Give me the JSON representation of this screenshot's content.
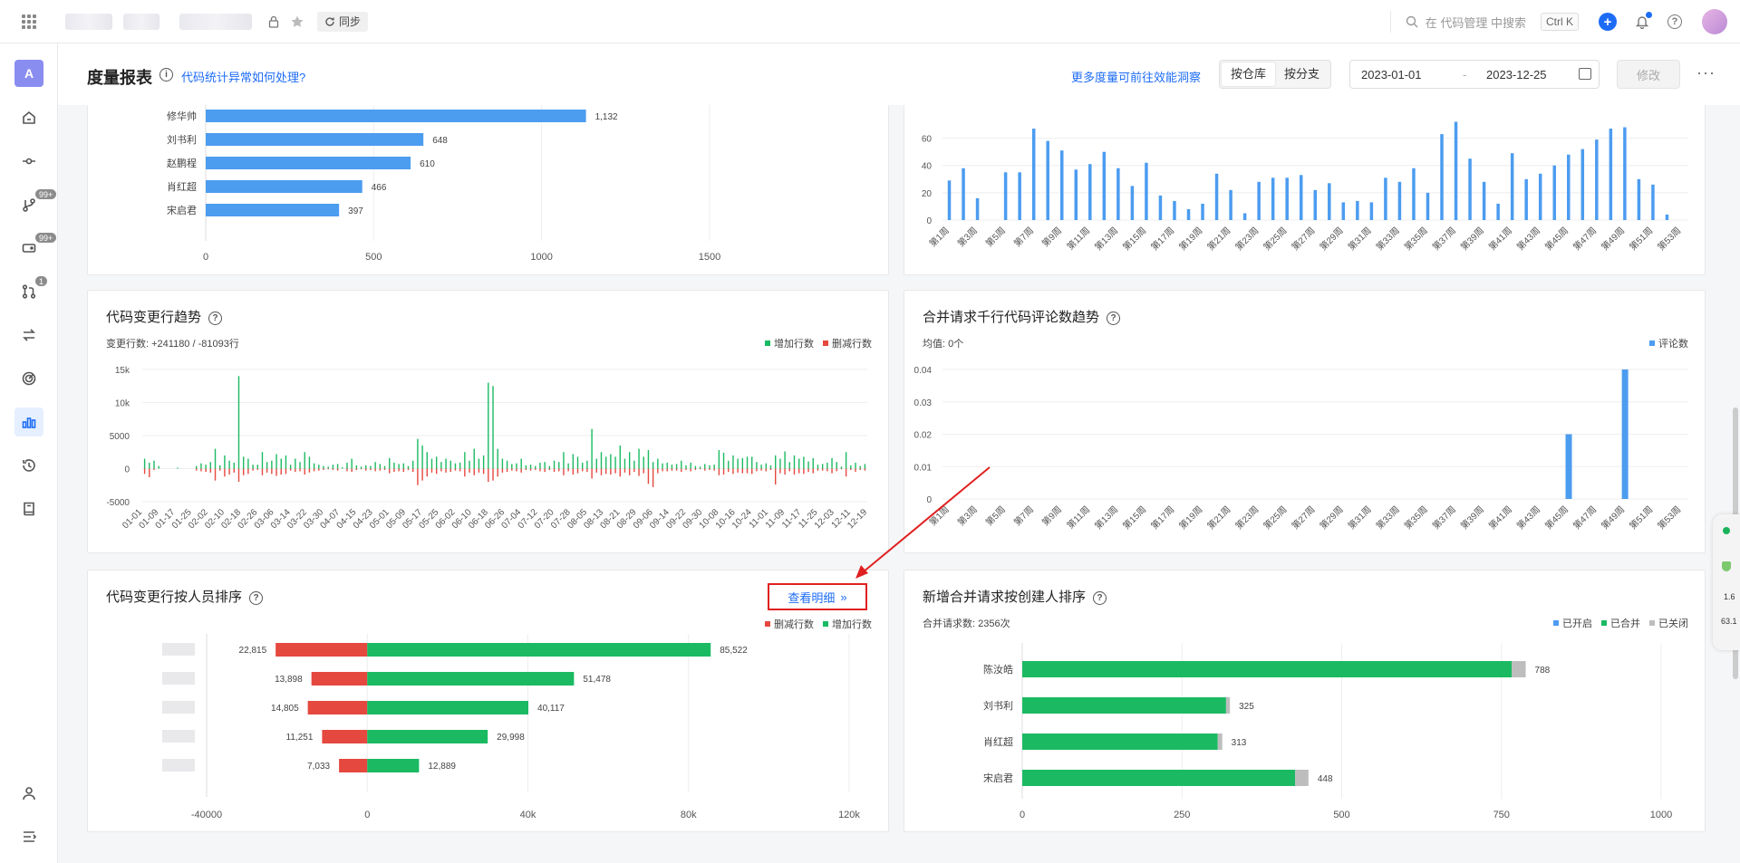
{
  "topbar": {
    "sync_label": "同步",
    "search_placeholder": "在 代码管理 中搜索",
    "shortcut": "Ctrl K",
    "plus": "+",
    "help": "?"
  },
  "sidebar": {
    "avatar_letter": "A",
    "badges": {
      "branch": "99+",
      "tag": "99+",
      "merge": "1"
    }
  },
  "header": {
    "title": "度量报表",
    "info_icon": "i",
    "info_link": "代码统计异常如何处理?",
    "more_link": "更多度量可前往效能洞察",
    "tabs": [
      "按仓库",
      "按分支"
    ],
    "date_start": "2023-01-01",
    "date_sep": "-",
    "date_end": "2023-12-25",
    "modify": "修改",
    "more": "···"
  },
  "panel_code_trend": {
    "title": "代码变更行趋势",
    "subtitle": "变更行数: +241180 / -81093行",
    "legend": [
      "增加行数",
      "删减行数"
    ]
  },
  "panel_comment_trend": {
    "title": "合并请求千行代码评论数趋势",
    "subtitle": "均值: 0个",
    "legend": [
      "评论数"
    ]
  },
  "panel_person_rank": {
    "title": "代码变更行按人员排序",
    "detail_button": "查看明细",
    "detail_chevron": "»",
    "legend": [
      "删减行数",
      "增加行数"
    ]
  },
  "panel_mr_rank": {
    "title": "新增合并请求按创建人排序",
    "subtitle": "合并请求数: 2356次",
    "legend": [
      "已开启",
      "已合并",
      "已关闭"
    ]
  },
  "float_widget": {
    "a": "1.6",
    "b": "63.1"
  },
  "colors": {
    "blue": "#4c9cf0",
    "green": "#1bba62",
    "red": "#e5483f",
    "gray": "#bdbdbd",
    "link": "#1d6cf6"
  },
  "chart_data": [
    {
      "type": "bar",
      "orientation": "horizontal",
      "partial": "top-left panel, scrolled",
      "categories": [
        "修华帅",
        "刘书利",
        "赵鹏程",
        "肖红超",
        "宋启君"
      ],
      "values": [
        1132,
        648,
        610,
        466,
        397
      ],
      "data_labels": [
        "1,132",
        "648",
        "610",
        "466",
        "397"
      ],
      "x_ticks": [
        "0",
        "500",
        "1000",
        "1500"
      ],
      "xlim": [
        0,
        1500
      ]
    },
    {
      "type": "bar",
      "partial": "top-right panel, scrolled",
      "categories": [
        "第1周",
        "第2周",
        "第3周",
        "第4周",
        "第5周",
        "第6周",
        "第7周",
        "第8周",
        "第9周",
        "第10周",
        "第11周",
        "第12周",
        "第13周",
        "第14周",
        "第15周",
        "第16周",
        "第17周",
        "第18周",
        "第19周",
        "第20周",
        "第21周",
        "第22周",
        "第23周",
        "第24周",
        "第25周",
        "第26周",
        "第27周",
        "第28周",
        "第29周",
        "第30周",
        "第31周",
        "第32周",
        "第33周",
        "第34周",
        "第35周",
        "第36周",
        "第37周",
        "第38周",
        "第39周",
        "第40周",
        "第41周",
        "第42周",
        "第43周",
        "第44周",
        "第45周",
        "第46周",
        "第47周",
        "第48周",
        "第49周",
        "第50周",
        "第51周",
        "第52周",
        "第53周"
      ],
      "values": [
        29,
        38,
        16,
        0,
        35,
        35,
        67,
        58,
        51,
        37,
        41,
        50,
        38,
        25,
        42,
        18,
        14,
        8,
        12,
        34,
        22,
        5,
        28,
        31,
        31,
        33,
        22,
        27,
        13,
        14,
        13,
        31,
        28,
        38,
        20,
        63,
        72,
        45,
        28,
        12,
        49,
        30,
        34,
        40,
        48,
        52,
        59,
        67,
        68,
        30,
        26,
        4,
        0
      ],
      "x_tick_labels": [
        "第1周",
        "第3周",
        "第5周",
        "第7周",
        "第9周",
        "第11周",
        "第13周",
        "第15周",
        "第17周",
        "第19周",
        "第21周",
        "第23周",
        "第25周",
        "第27周",
        "第29周",
        "第31周",
        "第33周",
        "第35周",
        "第37周",
        "第39周",
        "第41周",
        "第43周",
        "第45周",
        "第47周",
        "第49周",
        "第51周",
        "第53周"
      ],
      "y_ticks": [
        "0",
        "20",
        "40",
        "60"
      ],
      "ylim": [
        0,
        75
      ]
    },
    {
      "type": "bar",
      "title": "代码变更行趋势",
      "series": [
        {
          "name": "增加行数",
          "color": "#1bba62",
          "values": [
            1500,
            900,
            1200,
            400,
            0,
            0,
            0,
            150,
            0,
            0,
            0,
            400,
            800,
            600,
            1000,
            3000,
            500,
            2000,
            1200,
            900,
            14000,
            1800,
            1500,
            600,
            600,
            2500,
            1000,
            1200,
            2200,
            1500,
            2000,
            600,
            1500,
            1000,
            2500,
            1800,
            800,
            600,
            400,
            300,
            600,
            700,
            200,
            900,
            1500,
            500,
            300,
            500,
            400,
            1000,
            700,
            400,
            1600,
            900,
            700,
            800,
            400,
            1200,
            4500,
            3500,
            2500,
            1500,
            1800,
            1000,
            1500,
            1200,
            800,
            900,
            2500,
            1200,
            3000,
            1500,
            2000,
            13000,
            12500,
            3000,
            1500,
            1200,
            700,
            800,
            1500,
            500,
            600,
            400,
            900,
            1000,
            400,
            1200,
            1000,
            2500,
            800,
            2200,
            1800,
            900,
            1200,
            6000,
            1500,
            2500,
            1800,
            2200,
            1800,
            3500,
            1500,
            2500,
            1200,
            3000,
            1800,
            2800,
            1000,
            1500,
            800,
            900,
            600,
            700,
            1200,
            500,
            900,
            400,
            300,
            700,
            500,
            600,
            2800,
            2400,
            1200,
            2000,
            1500,
            1600,
            1800,
            1800,
            1000,
            600,
            800,
            500,
            2000,
            1500,
            2600,
            1000,
            2000,
            1500,
            1800,
            1100,
            1600,
            600,
            700,
            900,
            1600,
            1000,
            300,
            2500,
            500,
            900,
            400,
            700
          ]
        },
        {
          "name": "删减行数",
          "color": "#e5483f",
          "values": [
            -800,
            -1300,
            -200,
            0,
            0,
            0,
            0,
            0,
            0,
            0,
            0,
            -300,
            -400,
            -500,
            -600,
            -1800,
            -300,
            -1200,
            -900,
            -600,
            -2000,
            -1000,
            -800,
            -300,
            -200,
            -1000,
            -600,
            -800,
            -1100,
            -900,
            -800,
            -300,
            -500,
            -400,
            -900,
            -600,
            -400,
            -300,
            -200,
            -100,
            -200,
            -300,
            0,
            -400,
            -500,
            -200,
            -100,
            -300,
            -200,
            -400,
            -300,
            -200,
            -700,
            -500,
            -400,
            -500,
            -200,
            -500,
            -2500,
            -1800,
            -1200,
            -600,
            -800,
            -400,
            -600,
            -500,
            -300,
            -400,
            -1200,
            -600,
            -1000,
            -600,
            -800,
            -2000,
            -1800,
            -1200,
            -600,
            -500,
            -300,
            -400,
            -600,
            -200,
            -300,
            -200,
            -400,
            -500,
            -200,
            -500,
            -400,
            -1000,
            -400,
            -900,
            -700,
            -400,
            -500,
            -1500,
            -600,
            -1000,
            -800,
            -900,
            -700,
            -1200,
            -600,
            -1000,
            -500,
            -1100,
            -700,
            -2300,
            -2800,
            -700,
            -400,
            -400,
            -300,
            -300,
            -500,
            -200,
            -400,
            -200,
            -100,
            -300,
            -200,
            -300,
            -1000,
            -900,
            -500,
            -800,
            -600,
            -700,
            -700,
            -800,
            -400,
            -300,
            -400,
            -200,
            -2400,
            -700,
            -900,
            -400,
            -900,
            -700,
            -800,
            -500,
            -700,
            -300,
            -300,
            -400,
            -700,
            -400,
            -100,
            -1200,
            -200,
            -500,
            -200,
            -300
          ]
        }
      ],
      "x_tick_labels": [
        "01-01",
        "01-09",
        "01-17",
        "01-25",
        "02-02",
        "02-10",
        "02-18",
        "02-26",
        "03-06",
        "03-14",
        "03-22",
        "03-30",
        "04-07",
        "04-15",
        "04-23",
        "05-01",
        "05-09",
        "05-17",
        "05-25",
        "06-02",
        "06-10",
        "06-18",
        "06-26",
        "07-04",
        "07-12",
        "07-20",
        "07-28",
        "08-05",
        "08-13",
        "08-21",
        "08-29",
        "09-06",
        "09-14",
        "09-22",
        "09-30",
        "10-08",
        "10-16",
        "10-24",
        "11-01",
        "11-09",
        "11-17",
        "11-25",
        "12-03",
        "12-11",
        "12-19"
      ],
      "y_ticks": [
        "15k",
        "10k",
        "5000",
        "0",
        "-5000"
      ],
      "ylim": [
        -5000,
        15000
      ]
    },
    {
      "type": "bar",
      "title": "合并请求千行代码评论数趋势",
      "series": [
        {
          "name": "评论数",
          "color": "#4c9cf0",
          "points": [
            {
              "x": "第45周",
              "y": 0.02
            },
            {
              "x": "第49周",
              "y": 0.04
            }
          ]
        }
      ],
      "x_tick_labels": [
        "第1周",
        "第3周",
        "第5周",
        "第7周",
        "第9周",
        "第11周",
        "第13周",
        "第15周",
        "第17周",
        "第19周",
        "第21周",
        "第23周",
        "第25周",
        "第27周",
        "第29周",
        "第31周",
        "第33周",
        "第35周",
        "第37周",
        "第39周",
        "第41周",
        "第43周",
        "第45周",
        "第47周",
        "第49周",
        "第51周",
        "第53周"
      ],
      "y_ticks": [
        "0",
        "0.01",
        "0.02",
        "0.03",
        "0.04"
      ],
      "ylim": [
        0,
        0.04
      ]
    },
    {
      "type": "bar",
      "orientation": "horizontal-diverging",
      "title": "代码变更行按人员排序",
      "series": [
        {
          "name": "删减行数",
          "color": "#e5483f",
          "values": [
            22815,
            13898,
            14805,
            11251,
            7033
          ],
          "data_labels": [
            "22,815",
            "13,898",
            "14,805",
            "11,251",
            "7,033"
          ]
        },
        {
          "name": "增加行数",
          "color": "#1bba62",
          "values": [
            85522,
            51478,
            40117,
            29998,
            12889
          ],
          "data_labels": [
            "85,522",
            "51,478",
            "40,117",
            "29,998",
            "12,889"
          ]
        }
      ],
      "x_ticks": [
        "-40000",
        "0",
        "40k",
        "80k",
        "120k"
      ],
      "xlim": [
        -40000,
        120000
      ]
    },
    {
      "type": "bar",
      "orientation": "horizontal-stacked",
      "title": "新增合并请求按创建人排序",
      "categories": [
        "陈汝皓",
        "刘书利",
        "肖红超",
        "宋启君"
      ],
      "series": [
        {
          "name": "已开启",
          "color": "#4c9cf0",
          "values": [
            0,
            0,
            0,
            0
          ]
        },
        {
          "name": "已合并",
          "color": "#1bba62",
          "values": [
            766,
            319,
            306,
            427
          ]
        },
        {
          "name": "已关闭",
          "color": "#bdbdbd",
          "values": [
            22,
            6,
            7,
            21
          ]
        }
      ],
      "totals": [
        "788",
        "325",
        "313",
        "448"
      ],
      "x_ticks": [
        "0",
        "250",
        "500",
        "750",
        "1000"
      ],
      "xlim": [
        0,
        1000
      ]
    }
  ]
}
